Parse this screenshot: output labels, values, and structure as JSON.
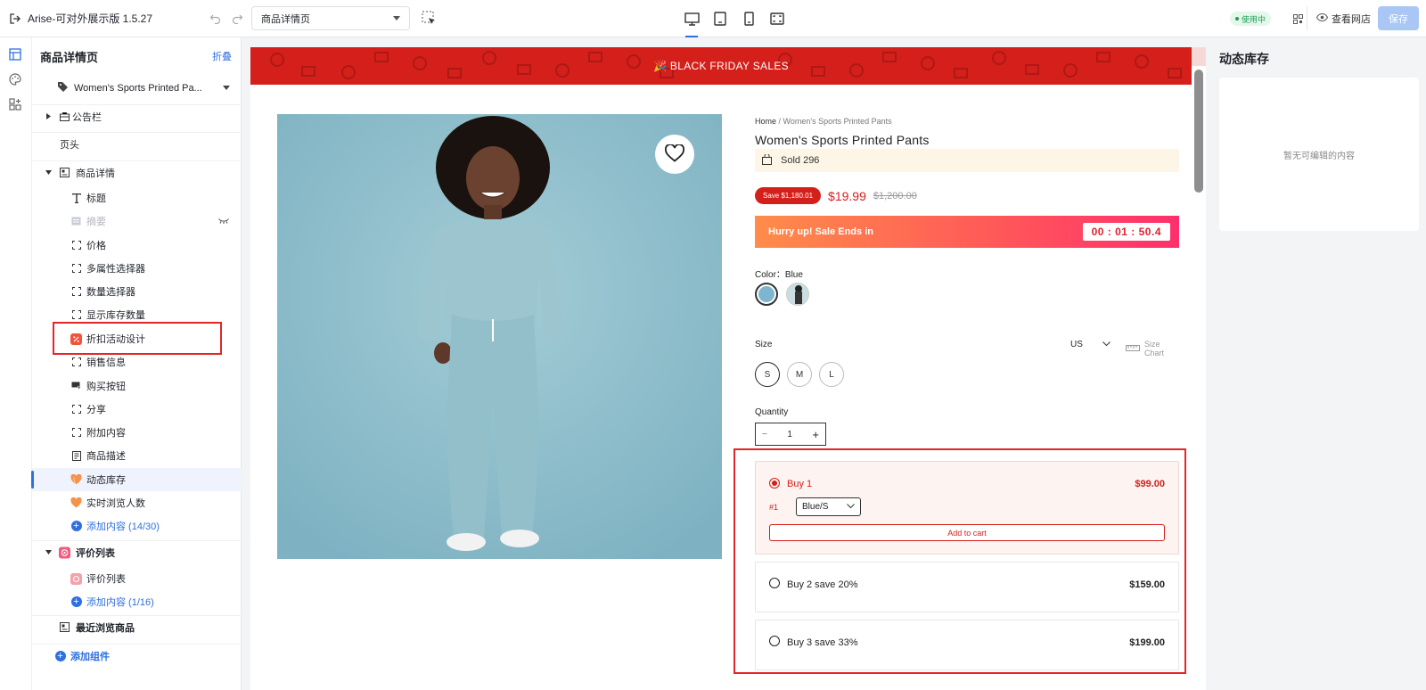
{
  "topbar": {
    "app_title": "Arise-可对外展示版 1.5.27",
    "page_select": "商品详情页",
    "status": "使用中",
    "view_store": "查看网店",
    "save": "保存"
  },
  "sidebar": {
    "title": "商品详情页",
    "fold": "折叠",
    "product": "Women's Sports Printed Pa...",
    "rows": [
      {
        "label": "公告栏"
      },
      {
        "label": "页头"
      },
      {
        "label": "商品详情"
      },
      {
        "label": "标题"
      },
      {
        "label": "摘要"
      },
      {
        "label": "价格"
      },
      {
        "label": "多属性选择器"
      },
      {
        "label": "数量选择器"
      },
      {
        "label": "显示库存数量"
      },
      {
        "label": "折扣活动设计"
      },
      {
        "label": "销售信息"
      },
      {
        "label": "购买按钮"
      },
      {
        "label": "分享"
      },
      {
        "label": "附加内容"
      },
      {
        "label": "商品描述"
      },
      {
        "label": "动态库存"
      },
      {
        "label": "实时浏览人数"
      },
      {
        "label": "添加内容 (14/30)"
      },
      {
        "label": "评价列表"
      },
      {
        "label": "评价列表"
      },
      {
        "label": "添加内容 (1/16)"
      },
      {
        "label": "最近浏览商品"
      },
      {
        "label": "添加组件"
      }
    ]
  },
  "canvas": {
    "promo_text": "🎉 BLACK FRIDAY SALES",
    "breadcrumb_home": "Home",
    "breadcrumb_sep": " / ",
    "breadcrumb_current": "Women's Sports Printed Pants",
    "product_title": "Women's Sports Printed Pants",
    "sold": "Sold 296",
    "save_badge": "Save $1,180.01",
    "price": "$19.99",
    "price_old": "$1,200.00",
    "countdown_label": "Hurry up! Sale Ends in",
    "countdown_time": "00 : 01 : 50.4",
    "color_label": "Color：Blue",
    "size_label": "Size",
    "region": "US",
    "size_chart": "Size Chart",
    "sizes": [
      "S",
      "M",
      "L"
    ],
    "quantity_label": "Quantity",
    "quantity_value": "1",
    "quantity_minus": "−",
    "quantity_plus": "+",
    "bundles": [
      {
        "label": "Buy 1",
        "price": "$99.00",
        "variant_num": "#1",
        "variant": "Blue/S",
        "add_to_cart": "Add to cart"
      },
      {
        "label": "Buy 2 save 20%",
        "price": "$159.00"
      },
      {
        "label": "Buy 3 save 33%",
        "price": "$199.00"
      }
    ]
  },
  "right_panel": {
    "title": "动态库存",
    "empty": "暂无可编辑的内容"
  },
  "colors": {
    "accent": "#2f6fdf",
    "promo_red": "#d41f1a",
    "highlight_red": "#e3262a",
    "swatch_blue": "#7fb6cf"
  }
}
